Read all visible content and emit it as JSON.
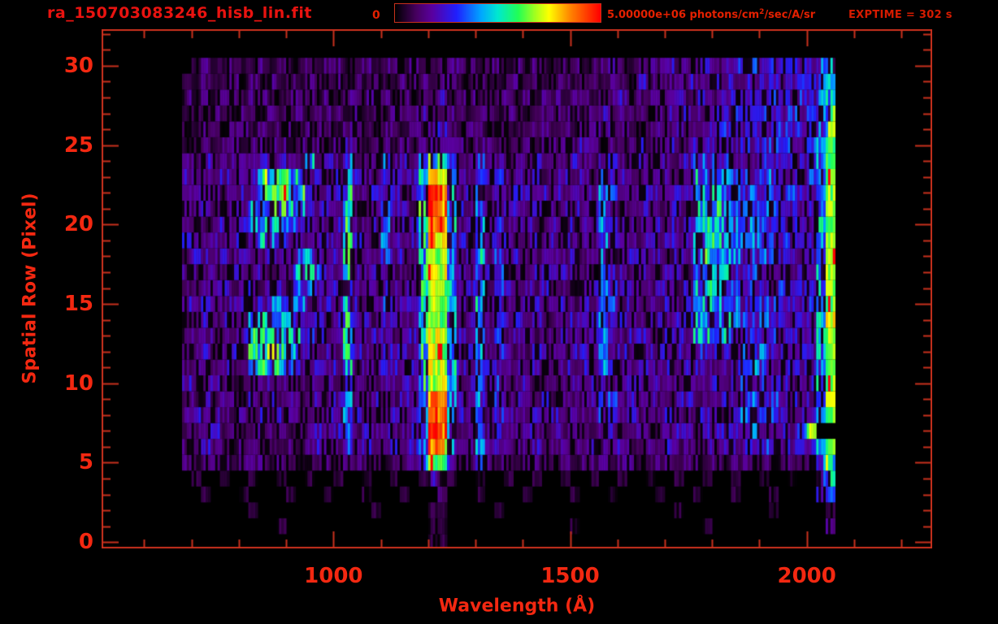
{
  "header": {
    "filename": "ra_150703083246_hisb_lin.fit",
    "colorbar_min": "0",
    "flux_label": {
      "pre": "5.00000e+06 photons/cm",
      "sup": "2",
      "post": "/sec/A/sr"
    },
    "exptime": "EXPTIME = 302 s"
  },
  "colors": {
    "accent_text": "#f32811",
    "header_text": "#e42000",
    "axis_stroke": "#c8301d",
    "background": "#000000"
  },
  "chart_data": {
    "type": "heatmap",
    "title": "ra_150703083246_hisb_lin.fit",
    "xlabel": "Wavelength (Å)",
    "ylabel": "Spatial Row (Pixel)",
    "x_range": [
      510,
      2265
    ],
    "y_range": [
      -0.4,
      32.3
    ],
    "x_ticks_major": [
      1000,
      1500,
      2000
    ],
    "x_tick_labels": [
      "1000",
      "1500",
      "2000"
    ],
    "x_minor_from": 600,
    "x_minor_to": 2200,
    "x_minor_step": 100,
    "y_ticks_major": [
      0,
      5,
      10,
      15,
      20,
      25,
      30
    ],
    "y_tick_labels": [
      "0",
      "5",
      "10",
      "15",
      "20",
      "25",
      "30"
    ],
    "y_minor_from": 0,
    "y_minor_to": 32,
    "y_minor_step": 1,
    "grid": false,
    "colorbar": {
      "min": 0,
      "max": 5000000,
      "units": "photons/cm2/sec/A/sr"
    },
    "colormap_stops": [
      [
        0.0,
        "#000000"
      ],
      [
        0.1,
        "#46005e"
      ],
      [
        0.18,
        "#5a00a0"
      ],
      [
        0.3,
        "#2020ff"
      ],
      [
        0.42,
        "#00a8ff"
      ],
      [
        0.5,
        "#00e8d0"
      ],
      [
        0.6,
        "#22ff55"
      ],
      [
        0.68,
        "#a0ff20"
      ],
      [
        0.75,
        "#ffff00"
      ],
      [
        0.85,
        "#ff8800"
      ],
      [
        1.0,
        "#ff0000"
      ]
    ],
    "wavelength_start": 680,
    "bin_width": 20,
    "intensity_encoding": "hex digit 0-15 per 20A bin, 15 = 5e6 photons/cm2/sec/A/sr",
    "rows_order": "bottom_to_top (spatial row 0 first)",
    "rows": [
      "000000000000000000000000001100000000000000000000000000000000000000000",
      "000000000010000000000000001100000000000001000000000000010000000000003",
      "000000010000000000001000001100000100000000000000000010000000001000001 3",
      "001000100001000100010001000200010000100001000100001000100010001000036",
      "010010010010010010010010013310010010010010010010010010010010010010047",
      "212221222122122214222122 25a9422422212221212221221222122121222212222 58",
      "2232212322221232252322323 6ec52252322232232232232232322332333353333 36a",
      "2223221232212232352323223 6fd52252322322322322322322233233333533 336a",
      "2323213232322323253223323 7fe63352432232323224323222332333235555333 36a",
      "2232321323232232352232232 6dc53253423223232235423232233232335554332 36a",
      "3223213223223223262323232 7bb62352422322223235223323223323234443323 36a",
      "2322322898873232372323323 7bb63263423232232325322332323332335543333 36a",
      "2232232988763323273224332 7ba62362432233223325232233232433324453323 36a",
      "3223223788776532372333233 7bb63263423322333235323322333676643444333 36a",
      "2332322676653332373323322 7ba62362433232223335432333233776754453433 36b",
      "3232233235665333273234333 7bb63263423332332325423232323667653544333 46a",
      "2323322323366533372323332 7ba62362432323223335433223323676543443433 36a",
      "3223232232236653373333223 7bb63263423233333225332322332767644544334 36a",
      "2332323223335632372224332 7ba62362433223223235423333233676653454343 36a",
      "3223232365533233273235323 7dc63263432332332325332232333667555554434 36b",
      "2322323677663323372335233 7ed62362423323323335433223323676655545343 46a",
      "3232232677766333273325332 7fd63263433232233235322332332667644454433 36a",
      "2323223389987323372234323 7fe62362423323323235433233233676554554343 36a",
      "3222322388987232363224333 6cb53253423232332324332322323666544445333 46a",
      "2232232232322623252326232 58742242332232223223322323223454433343333 369",
      "1221221222212221232122122 23322122212212222321222322322334334344343 469",
      "2122122121221222122212212 22321221221222121222322123232233433433434 358",
      "1212212212222122212121222 32222122122122222123222212323323343343343 468",
      "2121221221122212122222121 22312212221212212212232222232332334334434 358",
      "1121121212121221212121122 21221121122121221221221322223223333343334 457",
      "0121121121211212211212212 11222212212221122122321222322332343434343 357"
    ]
  }
}
